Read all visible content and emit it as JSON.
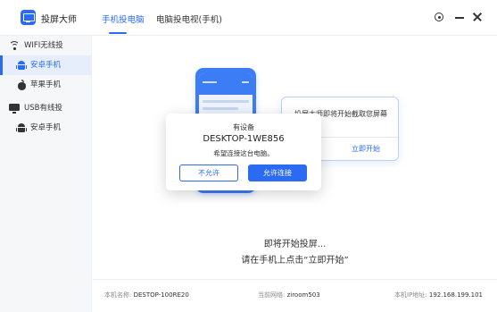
{
  "app": {
    "title": "投屏大师"
  },
  "tabs": [
    {
      "label": "手机投电脑",
      "active": true
    },
    {
      "label": "电脑投电视(手机)",
      "active": false
    }
  ],
  "window_controls": [
    "settings-icon",
    "minimize-icon",
    "close-icon"
  ],
  "sidebar": {
    "groups": [
      {
        "label": "WIFI无线投",
        "icon": "wifi-icon",
        "items": [
          {
            "label": "安卓手机",
            "icon": "android-icon",
            "active": true
          },
          {
            "label": "苹果手机",
            "icon": "apple-icon",
            "active": false
          }
        ]
      },
      {
        "label": "USB有线投",
        "icon": "usb-icon",
        "items": [
          {
            "label": "安卓手机",
            "icon": "android-icon",
            "active": false
          }
        ]
      }
    ]
  },
  "main": {
    "card_text": "投屏大师即将开始截取您屏幕内容。",
    "card_button": "立即开始",
    "status_line1": "即将开始投屏...",
    "status_line2": "请在手机上点击“立即开始”"
  },
  "dialog": {
    "title": "有设备",
    "device": "DESKTOP-1WE856",
    "message": "希望连接这台电脑。",
    "deny_label": "不允许",
    "allow_label": "允许连接"
  },
  "footer": {
    "machine_name_label": "本机名称:",
    "machine_name": "DESTOP-100RE20",
    "network_label": "当前网络:",
    "network": "ziroom503",
    "ip_label": "本机IP地址:",
    "ip": "192.168.199.101"
  },
  "colors": {
    "accent": "#2b6bf3",
    "sidebar_bg": "#f6f7f9",
    "active_bg": "#e6eefc"
  }
}
